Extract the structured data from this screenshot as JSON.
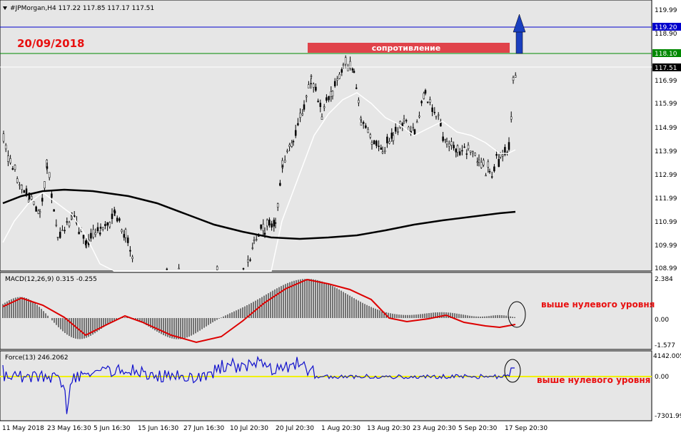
{
  "chart_header": "#JPMorgan,H4  117.22 117.85 117.17 117.51",
  "date_annotation": "20/09/2018",
  "resistance_label": "сопротивление",
  "macd_header": "MACD(12,26,9) 0.315 -0.255",
  "force_header": "Force(13) 246.2062",
  "macd_note": "выше нулевого уровня",
  "force_note": "выше нулевого уровня",
  "price_axis": [
    "119.99",
    "119.20",
    "118.90",
    "118.10",
    "117.51",
    "116.99",
    "115.99",
    "114.99",
    "113.99",
    "112.99",
    "111.99",
    "110.99",
    "109.99",
    "108.99"
  ],
  "highlighted_prices": {
    "blue": "119.20",
    "green": "118.10",
    "current": "117.51"
  },
  "macd_axis": [
    "2.384",
    "0.00",
    "-1.577"
  ],
  "force_axis": [
    "4142.005",
    "0.00",
    "-7301.99"
  ],
  "time_axis": [
    "11 May 2018",
    "23 May 16:30",
    "5 Jun 16:30",
    "15 Jun 16:30",
    "27 Jun 16:30",
    "10 Jul 20:30",
    "20 Jul 20:30",
    "1 Aug 20:30",
    "13 Aug 20:30",
    "23 Aug 20:30",
    "5 Sep 20:30",
    "17 Sep 20:30"
  ],
  "colors": {
    "resistance_box": "#e0434a",
    "annotation_red": "#e81010",
    "blue_line": "#0000cc",
    "green_line": "#008800",
    "arrow": "#1a3fbf",
    "macd_signal": "#dd0000",
    "force_line": "#1010cc",
    "force_zero": "#f0f000",
    "grid_bg": "#e6e6e6"
  },
  "icons": {
    "arrow": "arrow-up-icon",
    "macd_circle": "circle-highlight-icon",
    "force_circle": "circle-highlight-icon"
  }
}
